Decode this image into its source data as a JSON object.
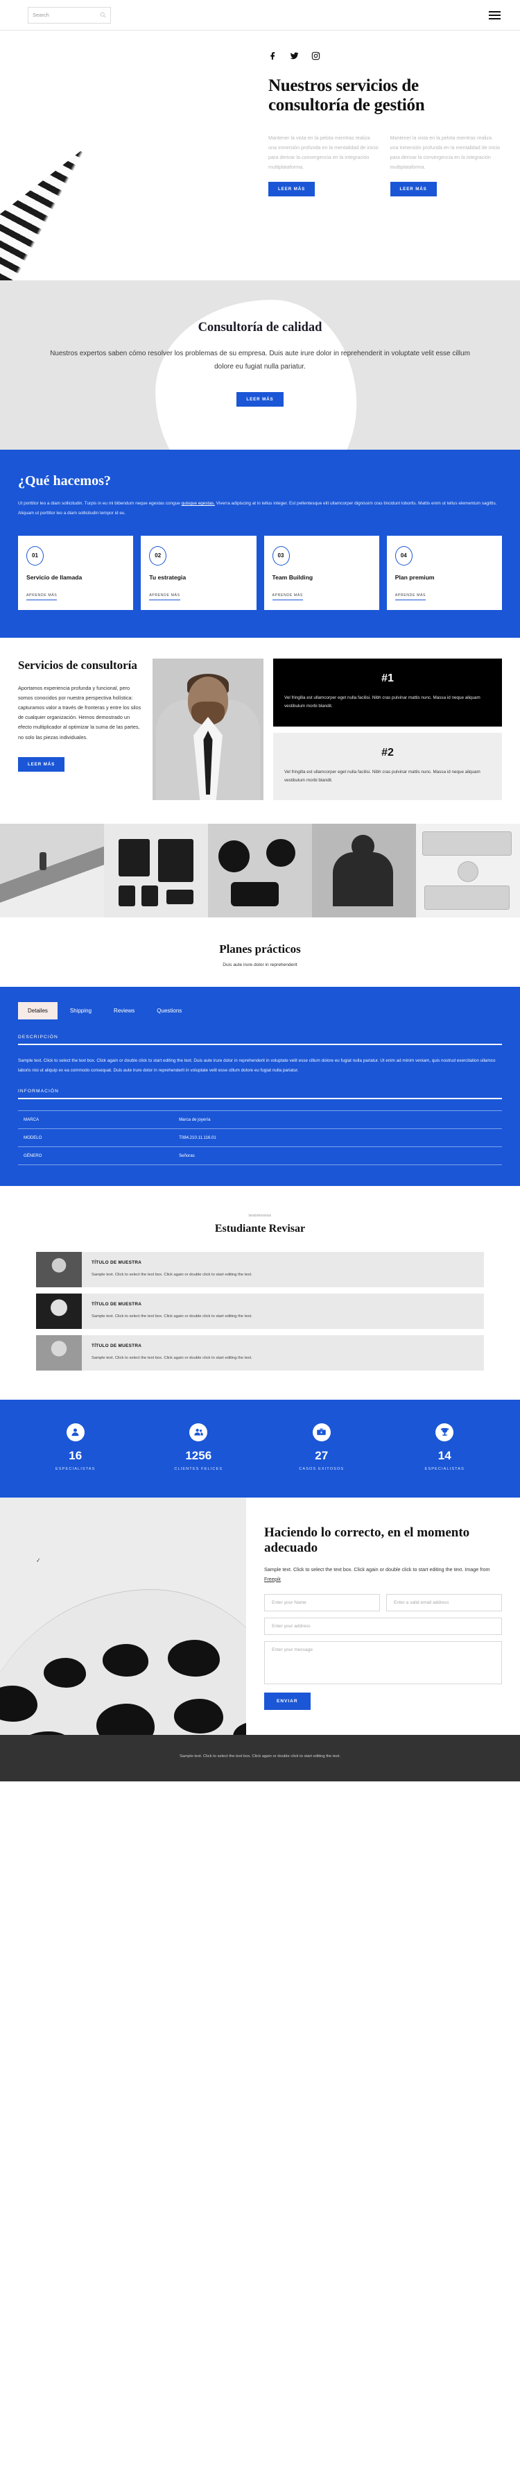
{
  "header": {
    "search_placeholder": "Search",
    "menu_label": "Menu"
  },
  "hero": {
    "socials": [
      "facebook-icon",
      "twitter-icon",
      "instagram-icon"
    ],
    "title": "Nuestros servicios de consultoría de gestión",
    "columns": [
      {
        "text": "Mantener la vista en la pelota mientras realiza una inmersión profunda en la mentalidad de inicio para derivar la convergencia en la integración multiplataforma.",
        "button": "LEER MÁS"
      },
      {
        "text": "Mantener la vista en la pelota mientras realiza una inmersión profunda en la mentalidad de inicio para derivar la convergencia en la integración multiplataforma.",
        "button": "LEER MÁS"
      }
    ]
  },
  "quality": {
    "title": "Consultoría de calidad",
    "text": "Nuestros expertos saben cómo resolver los problemas de su empresa. Duis aute irure dolor in reprehenderit in voluptate velit esse cillum dolore eu fugiat nulla pariatur.",
    "button": "LEER MÁS"
  },
  "whatwedo": {
    "title": "¿Qué hacemos?",
    "lead_part1": "Ut porttitor leo a diam sollicitudin. Turpis in eu mi bibendum neque egestas congue ",
    "lead_link": "quisque egestas.",
    "lead_part2": " Viverra adipiscing at in tellus integer. Est pellentesque elit ullamcorper dignissim cras tincidunt lobortis. Mattis enim ut tellus elementum sagittis. Aliquam ut porttitor leo a diam sollicitudin tempor id eu.",
    "cards": [
      {
        "num": "01",
        "title": "Servicio de llamada",
        "more": "APRENDE MÁS"
      },
      {
        "num": "02",
        "title": "Tu estrategia",
        "more": "APRENDE MÁS"
      },
      {
        "num": "03",
        "title": "Team Building",
        "more": "APRENDE MÁS"
      },
      {
        "num": "04",
        "title": "Plan premium",
        "more": "APRENDE MÁS"
      }
    ]
  },
  "services": {
    "title": "Servicios de consultoría",
    "text": "Aportamos experiencia profunda y funcional, pero somos conocidos por nuestra perspectiva holística: capturamos valor a través de fronteras y entre los silos de cualquier organización. Hemos demostrado un efecto multiplicador al optimizar la suma de las partes, no solo las piezas individuales.",
    "button": "LEER MÁS",
    "boxes": [
      {
        "hash": "#1",
        "text": "Vel fringilla est ullamcorper eget nulla facilisi. Nibh cras pulvinar mattis nunc. Massa id neque aliquam vestibulum morbi blandit."
      },
      {
        "hash": "#2",
        "text": "Vel fringilla est ullamcorper eget nulla facilisi. Nibh cras pulvinar mattis nunc. Massa id neque aliquam vestibulum morbi blandit."
      }
    ]
  },
  "plans": {
    "title": "Planes prácticos",
    "subtitle": "Duis aute irure dolor in reprehenderit",
    "tabs": [
      "Detailes",
      "Shipping",
      "Reviews",
      "Questions"
    ],
    "active_tab": "Detailes",
    "description_label": "DESCRIPCIÓN",
    "description_text": "Sample text. Click to select the text box. Click again or double click to start editing the text. Duis aute irure dolor in reprehenderit in voluptate velit esse cillum dolore eu fugiat nulla pariatur. Ut enim ad minim veniam, quis nostrud exercitation ullamco laboris nisi ut aliquip ex ea commodo consequat. Duis aute irure dolor in reprehenderit in voluptate velit esse cillum dolore eu fugiat nulla pariatur.",
    "information_label": "INFORMACIÓN",
    "info_rows": [
      {
        "key": "MARCA",
        "value": "Marca de joyería"
      },
      {
        "key": "MODELO",
        "value": "T084.210.11.116.01"
      },
      {
        "key": "GÉNERO",
        "value": "Señoras"
      }
    ]
  },
  "testimonials": {
    "kicker": "testimonios",
    "title": "Estudiante Revisar",
    "items": [
      {
        "title": "TÍTULO DE MUESTRA",
        "text": "Sample text. Click to select the text box. Click again or double click to start editing the text."
      },
      {
        "title": "TÍTULO DE MUESTRA",
        "text": "Sample text. Click to select the text box. Click again or double click to start editing the text."
      },
      {
        "title": "TÍTULO DE MUESTRA",
        "text": "Sample text. Click to select the text box. Click again or double click to start editing the text."
      }
    ]
  },
  "stats": [
    {
      "icon": "user-icon",
      "number": "16",
      "label": "ESPECIALISTAS"
    },
    {
      "icon": "group-icon",
      "number": "1256",
      "label": "CLIENTES FELICES"
    },
    {
      "icon": "briefcase-icon",
      "number": "27",
      "label": "CASOS EXITOSOS"
    },
    {
      "icon": "trophy-icon",
      "number": "14",
      "label": "ESPECIALISTAS"
    }
  ],
  "contact": {
    "title": "Haciendo lo correcto, en el momento adecuado",
    "sub_part1": "Sample text. Click to select the text box. Click again or double click to start editing the text. Image from ",
    "sub_link": "Freepik",
    "name_placeholder": "Enter your Name",
    "email_placeholder": "Enter a valid email address",
    "address_placeholder": "Enter your address",
    "message_placeholder": "Enter your message",
    "submit": "ENVIAR"
  },
  "footer": {
    "text": "Sample text. Click to select the text box. Click again or double click to start editing the text."
  },
  "colors": {
    "accent": "#1A56D6",
    "dark": "#000000",
    "footer": "#333333",
    "grey": "#e4e4e4"
  }
}
